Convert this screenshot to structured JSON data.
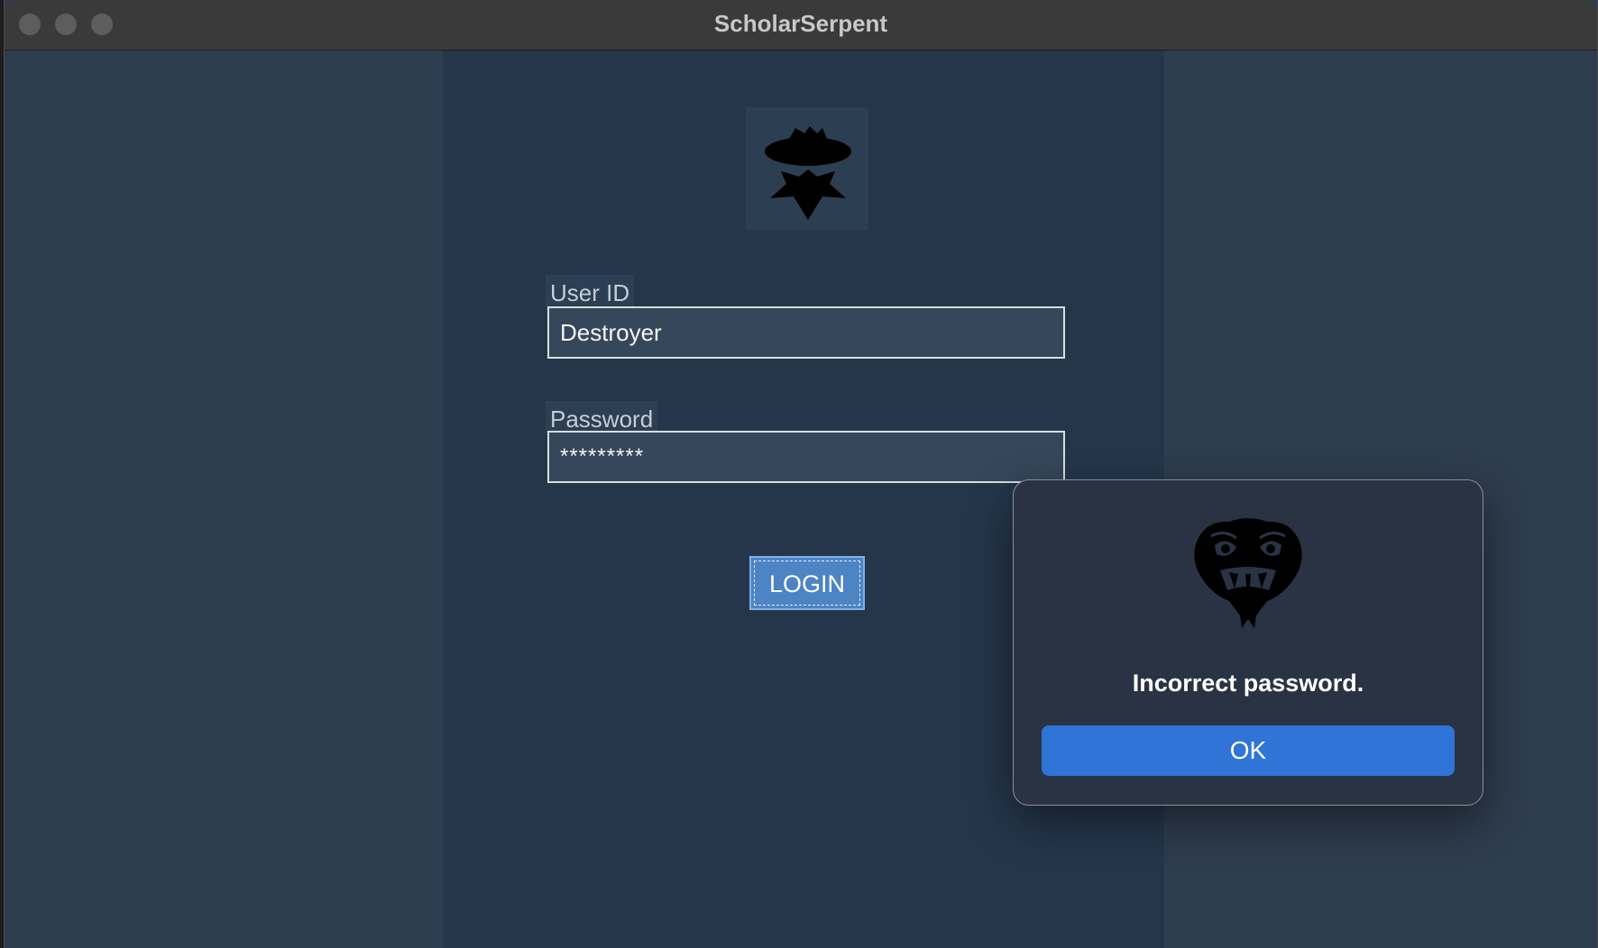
{
  "window": {
    "title": "ScholarSerpent"
  },
  "login_form": {
    "user_id_label": "User ID",
    "user_id_value": "Destroyer",
    "password_label": "Password",
    "password_value": "*********",
    "login_button": "LOGIN"
  },
  "dialog": {
    "message": "Incorrect password.",
    "ok_button": "OK"
  },
  "colors": {
    "app_background": "#2e3d4f",
    "center_panel": "#25364b",
    "login_button": "#4d84c4",
    "dialog_background": "#2a3343",
    "ok_button": "#2f74d6"
  },
  "icons": {
    "app_logo": "spy-icon",
    "dialog_icon": "snake-head-icon"
  }
}
